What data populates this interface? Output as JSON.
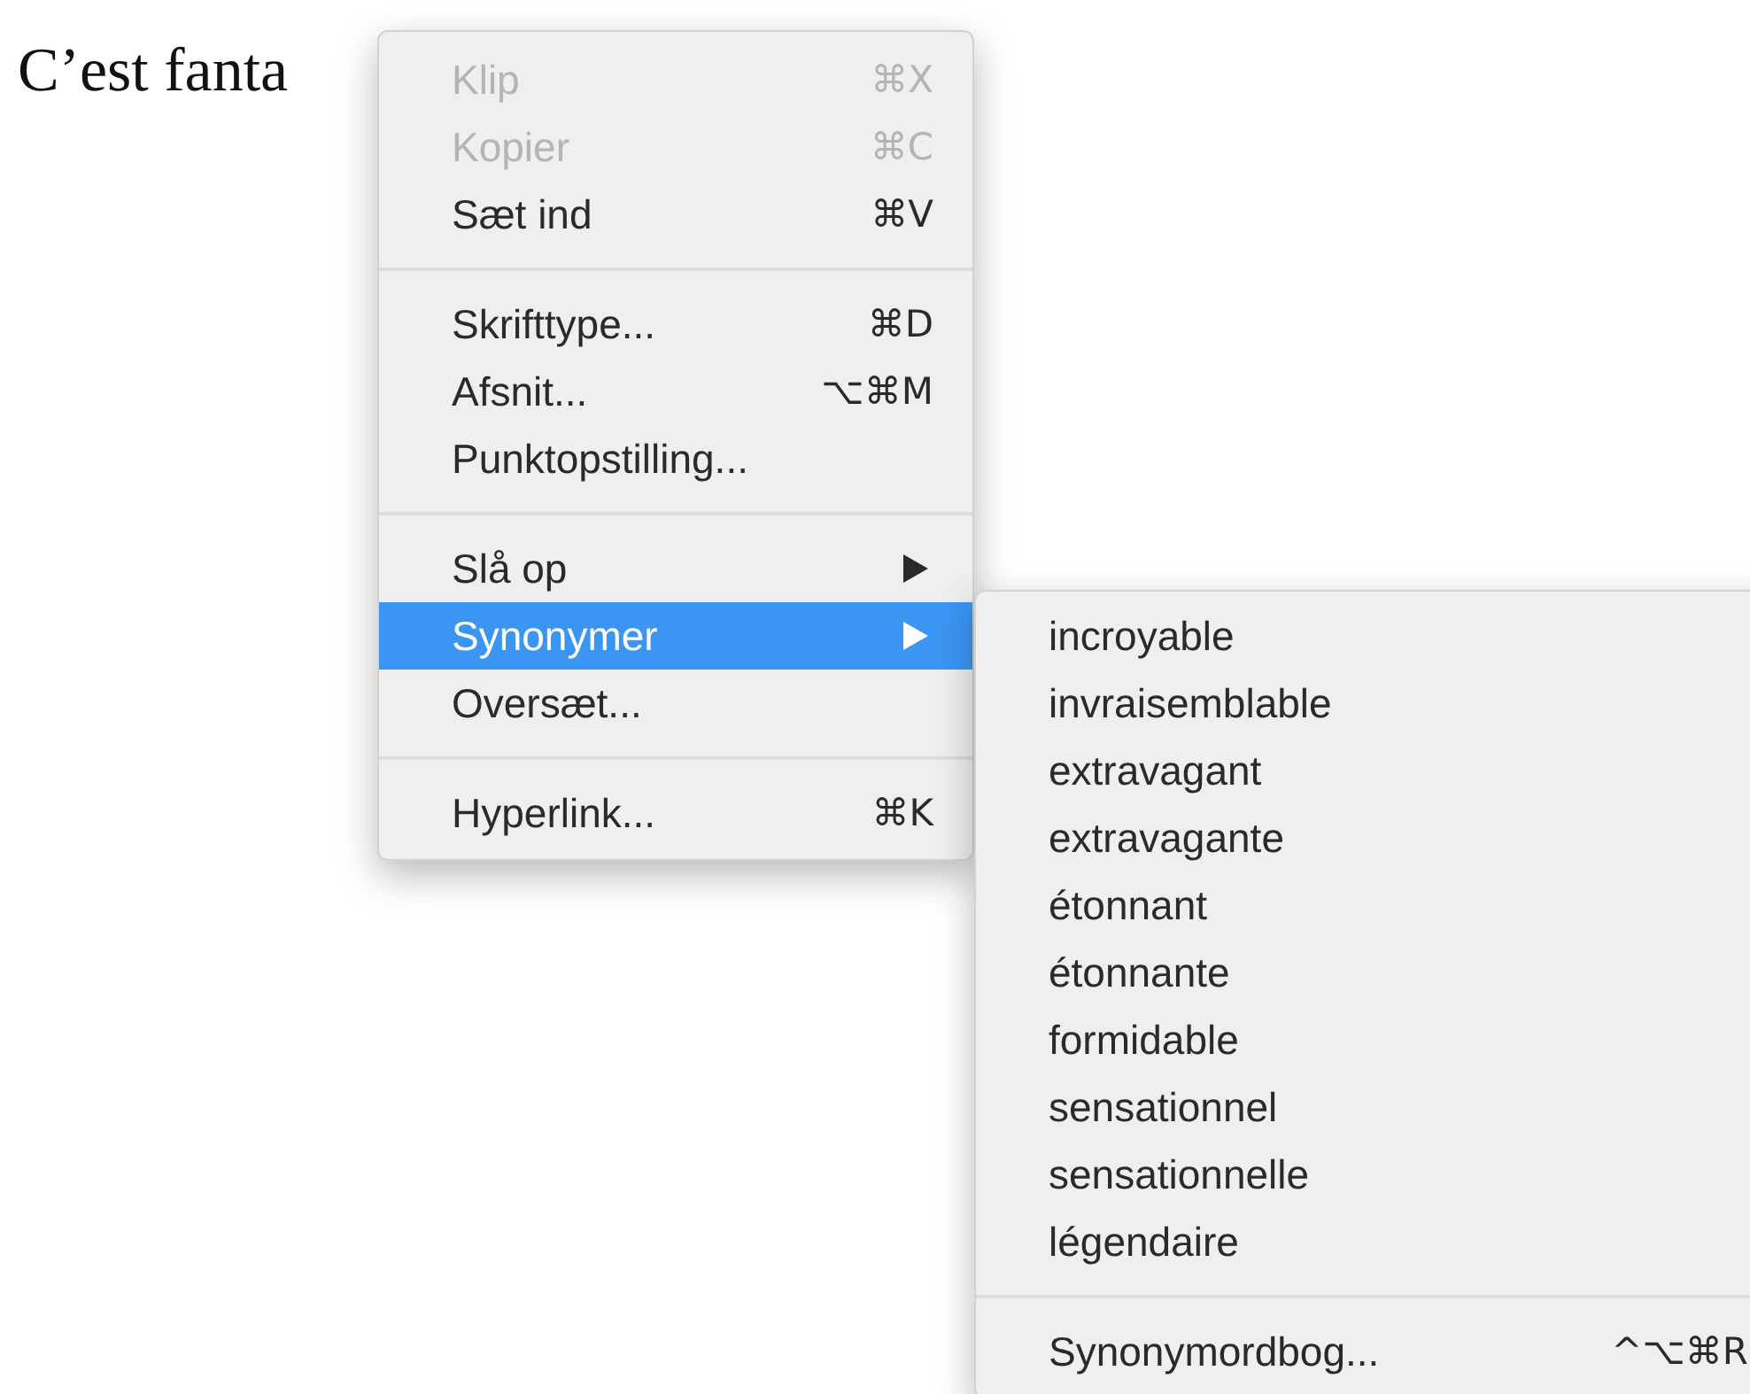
{
  "document": {
    "text": "C’est fanta"
  },
  "context_menu": {
    "items": [
      {
        "kind": "item",
        "label": "Klip",
        "shortcut": "⌘X",
        "disabled": true,
        "selected": false,
        "has_submenu": false
      },
      {
        "kind": "item",
        "label": "Kopier",
        "shortcut": "⌘C",
        "disabled": true,
        "selected": false,
        "has_submenu": false
      },
      {
        "kind": "item",
        "label": "Sæt ind",
        "shortcut": "⌘V",
        "disabled": false,
        "selected": false,
        "has_submenu": false
      },
      {
        "kind": "separator"
      },
      {
        "kind": "item",
        "label": "Skrifttype...",
        "shortcut": "⌘D",
        "disabled": false,
        "selected": false,
        "has_submenu": false
      },
      {
        "kind": "item",
        "label": "Afsnit...",
        "shortcut": "⌥⌘M",
        "disabled": false,
        "selected": false,
        "has_submenu": false
      },
      {
        "kind": "item",
        "label": "Punktopstilling...",
        "disabled": false,
        "selected": false,
        "has_submenu": false
      },
      {
        "kind": "separator"
      },
      {
        "kind": "item",
        "label": "Slå op",
        "disabled": false,
        "selected": false,
        "has_submenu": true
      },
      {
        "kind": "item",
        "label": "Synonymer",
        "disabled": false,
        "selected": true,
        "has_submenu": true
      },
      {
        "kind": "item",
        "label": "Oversæt...",
        "disabled": false,
        "selected": false,
        "has_submenu": false
      },
      {
        "kind": "separator"
      },
      {
        "kind": "item",
        "label": "Hyperlink...",
        "shortcut": "⌘K",
        "disabled": false,
        "selected": false,
        "has_submenu": false
      }
    ]
  },
  "submenu": {
    "items": [
      {
        "kind": "item",
        "label": "incroyable"
      },
      {
        "kind": "item",
        "label": "invraisemblable"
      },
      {
        "kind": "item",
        "label": "extravagant"
      },
      {
        "kind": "item",
        "label": "extravagante"
      },
      {
        "kind": "item",
        "label": "étonnant"
      },
      {
        "kind": "item",
        "label": "étonnante"
      },
      {
        "kind": "item",
        "label": "formidable"
      },
      {
        "kind": "item",
        "label": "sensationnel"
      },
      {
        "kind": "item",
        "label": "sensationnelle"
      },
      {
        "kind": "item",
        "label": "légendaire"
      },
      {
        "kind": "separator"
      },
      {
        "kind": "item",
        "label": "Synonymordbog...",
        "shortcut": "^⌥⌘R"
      }
    ]
  }
}
